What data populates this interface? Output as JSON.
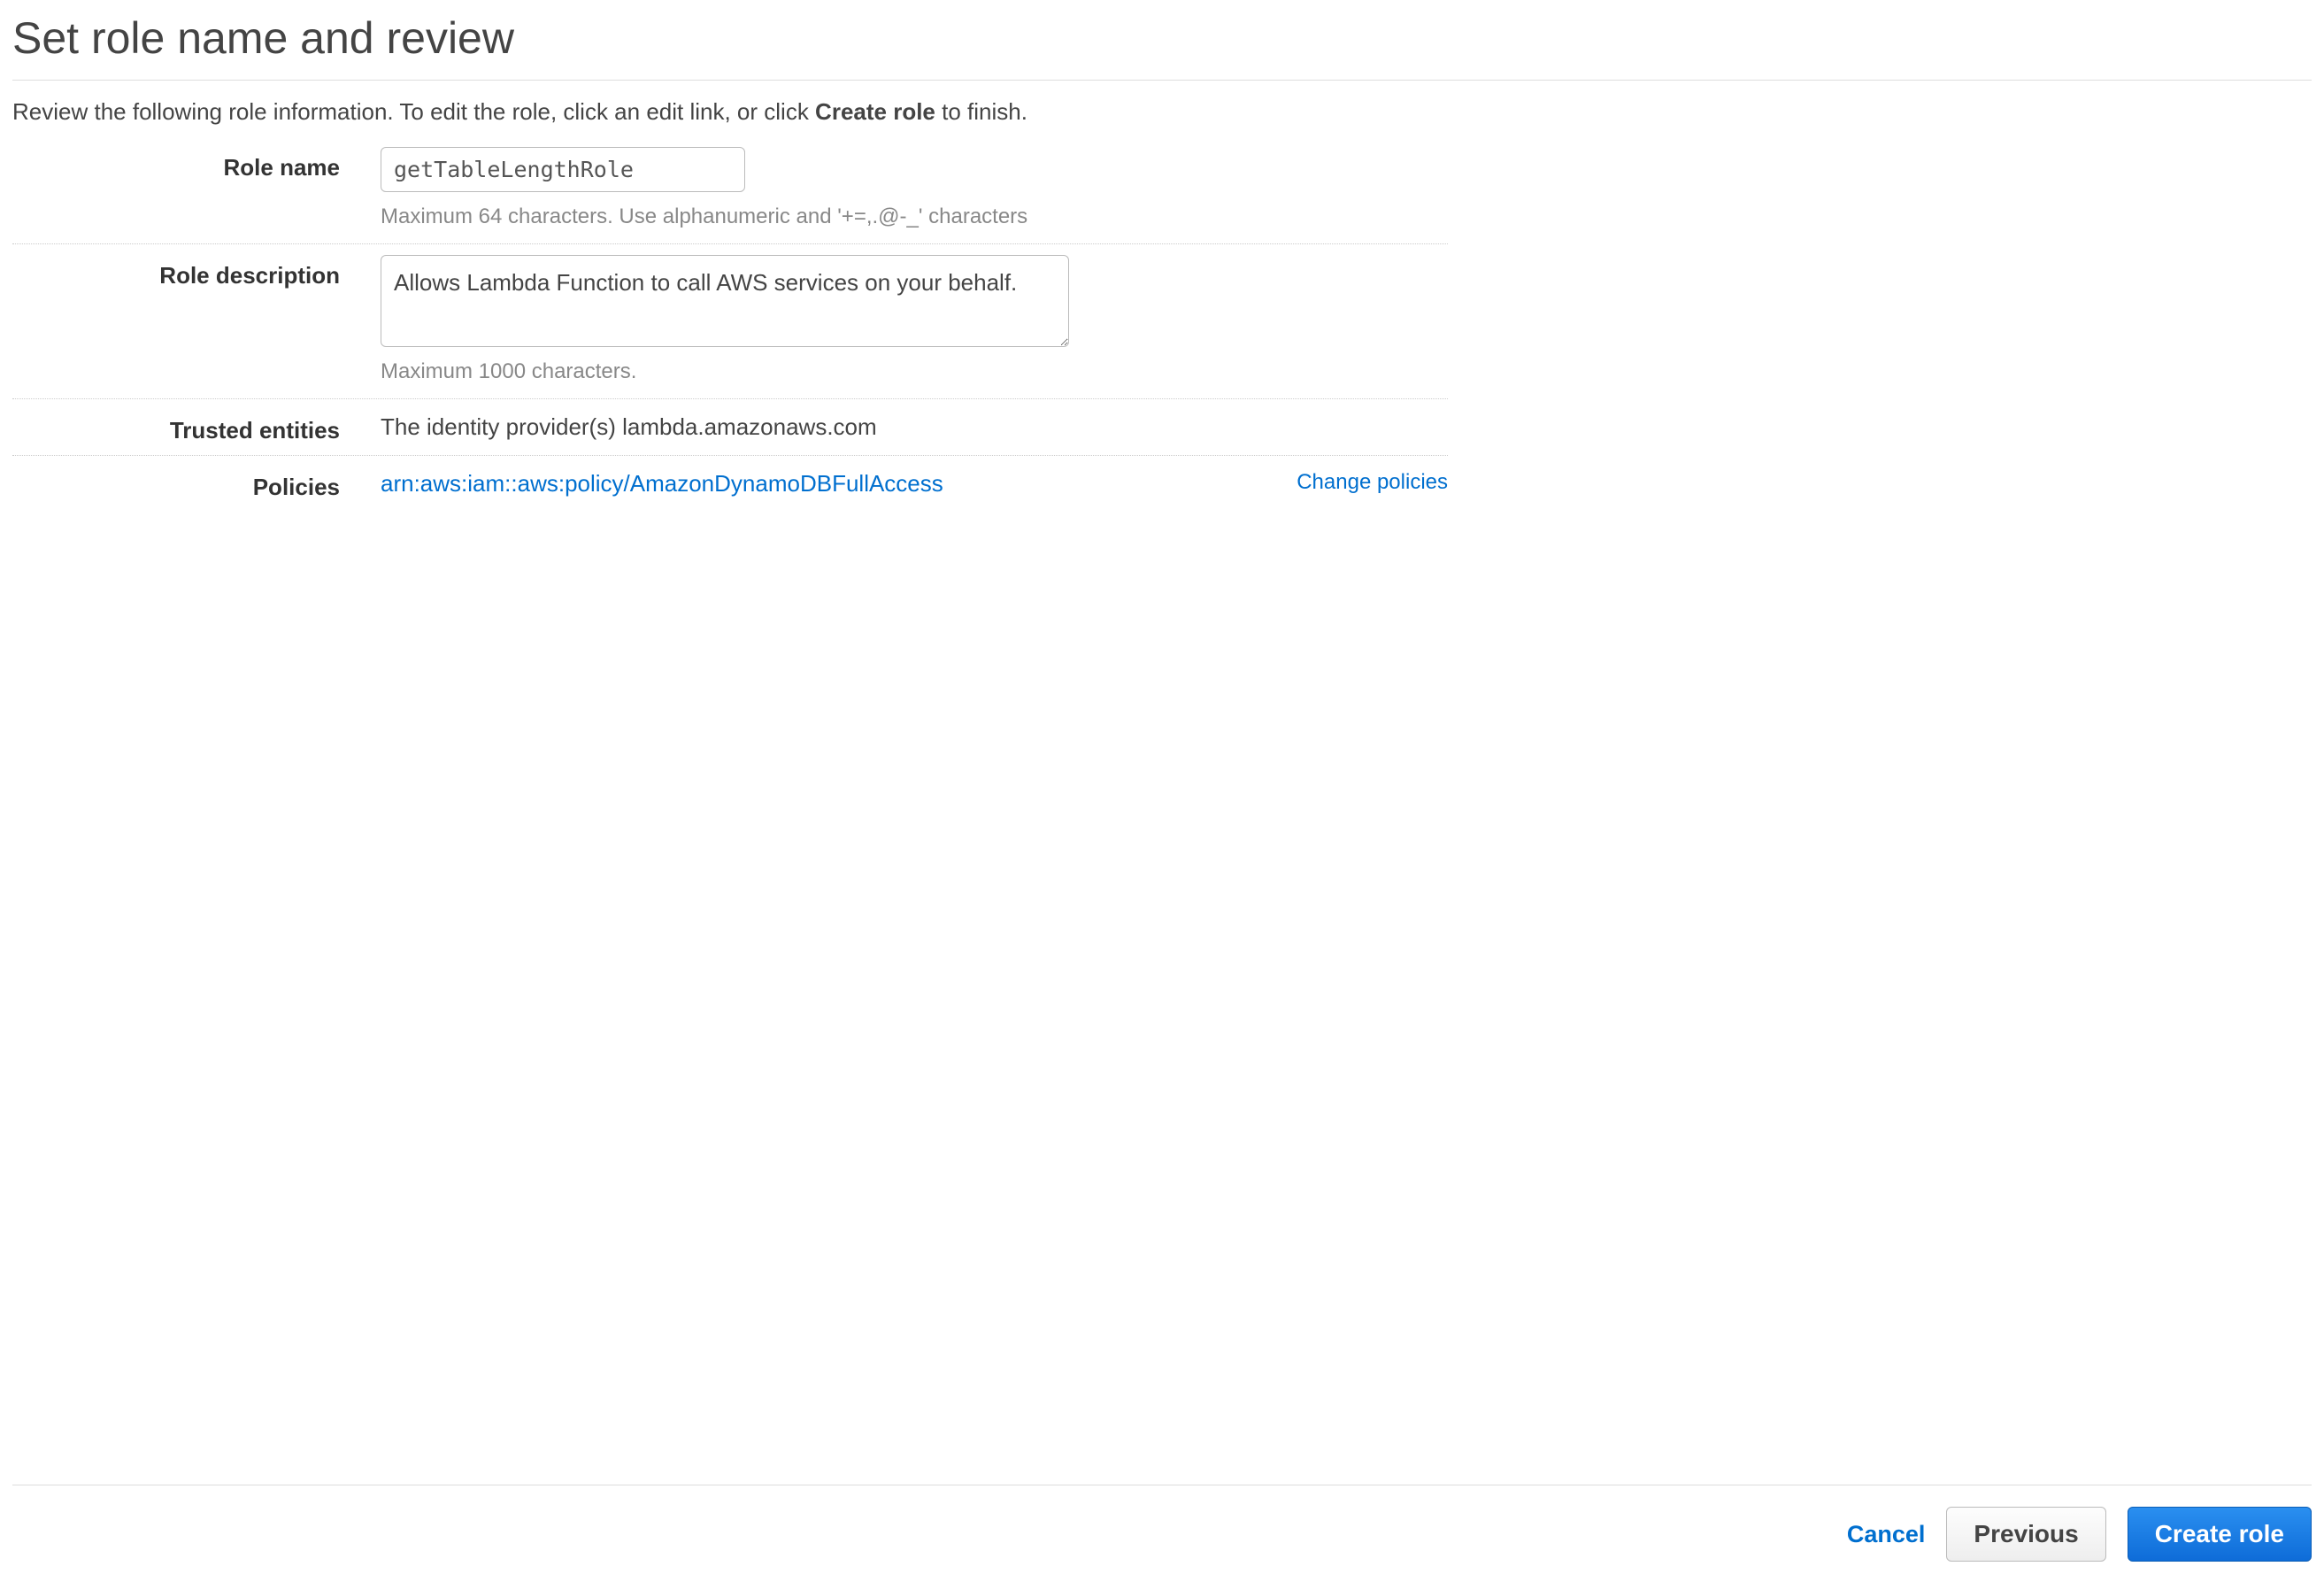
{
  "page": {
    "title": "Set role name and review",
    "intro_prefix": "Review the following role information. To edit the role, click an edit link, or click ",
    "intro_bold": "Create role",
    "intro_suffix": " to finish."
  },
  "form": {
    "role_name": {
      "label": "Role name",
      "value": "getTableLengthRole",
      "hint": "Maximum 64 characters. Use alphanumeric and '+=,.@-_' characters"
    },
    "role_description": {
      "label": "Role description",
      "value": "Allows Lambda Function to call AWS services on your behalf.",
      "hint": "Maximum 1000 characters."
    },
    "trusted_entities": {
      "label": "Trusted entities",
      "value": "The identity provider(s) lambda.amazonaws.com"
    },
    "policies": {
      "label": "Policies",
      "value": "arn:aws:iam::aws:policy/AmazonDynamoDBFullAccess",
      "change_link": "Change policies"
    }
  },
  "footer": {
    "cancel": "Cancel",
    "previous": "Previous",
    "create": "Create role"
  }
}
